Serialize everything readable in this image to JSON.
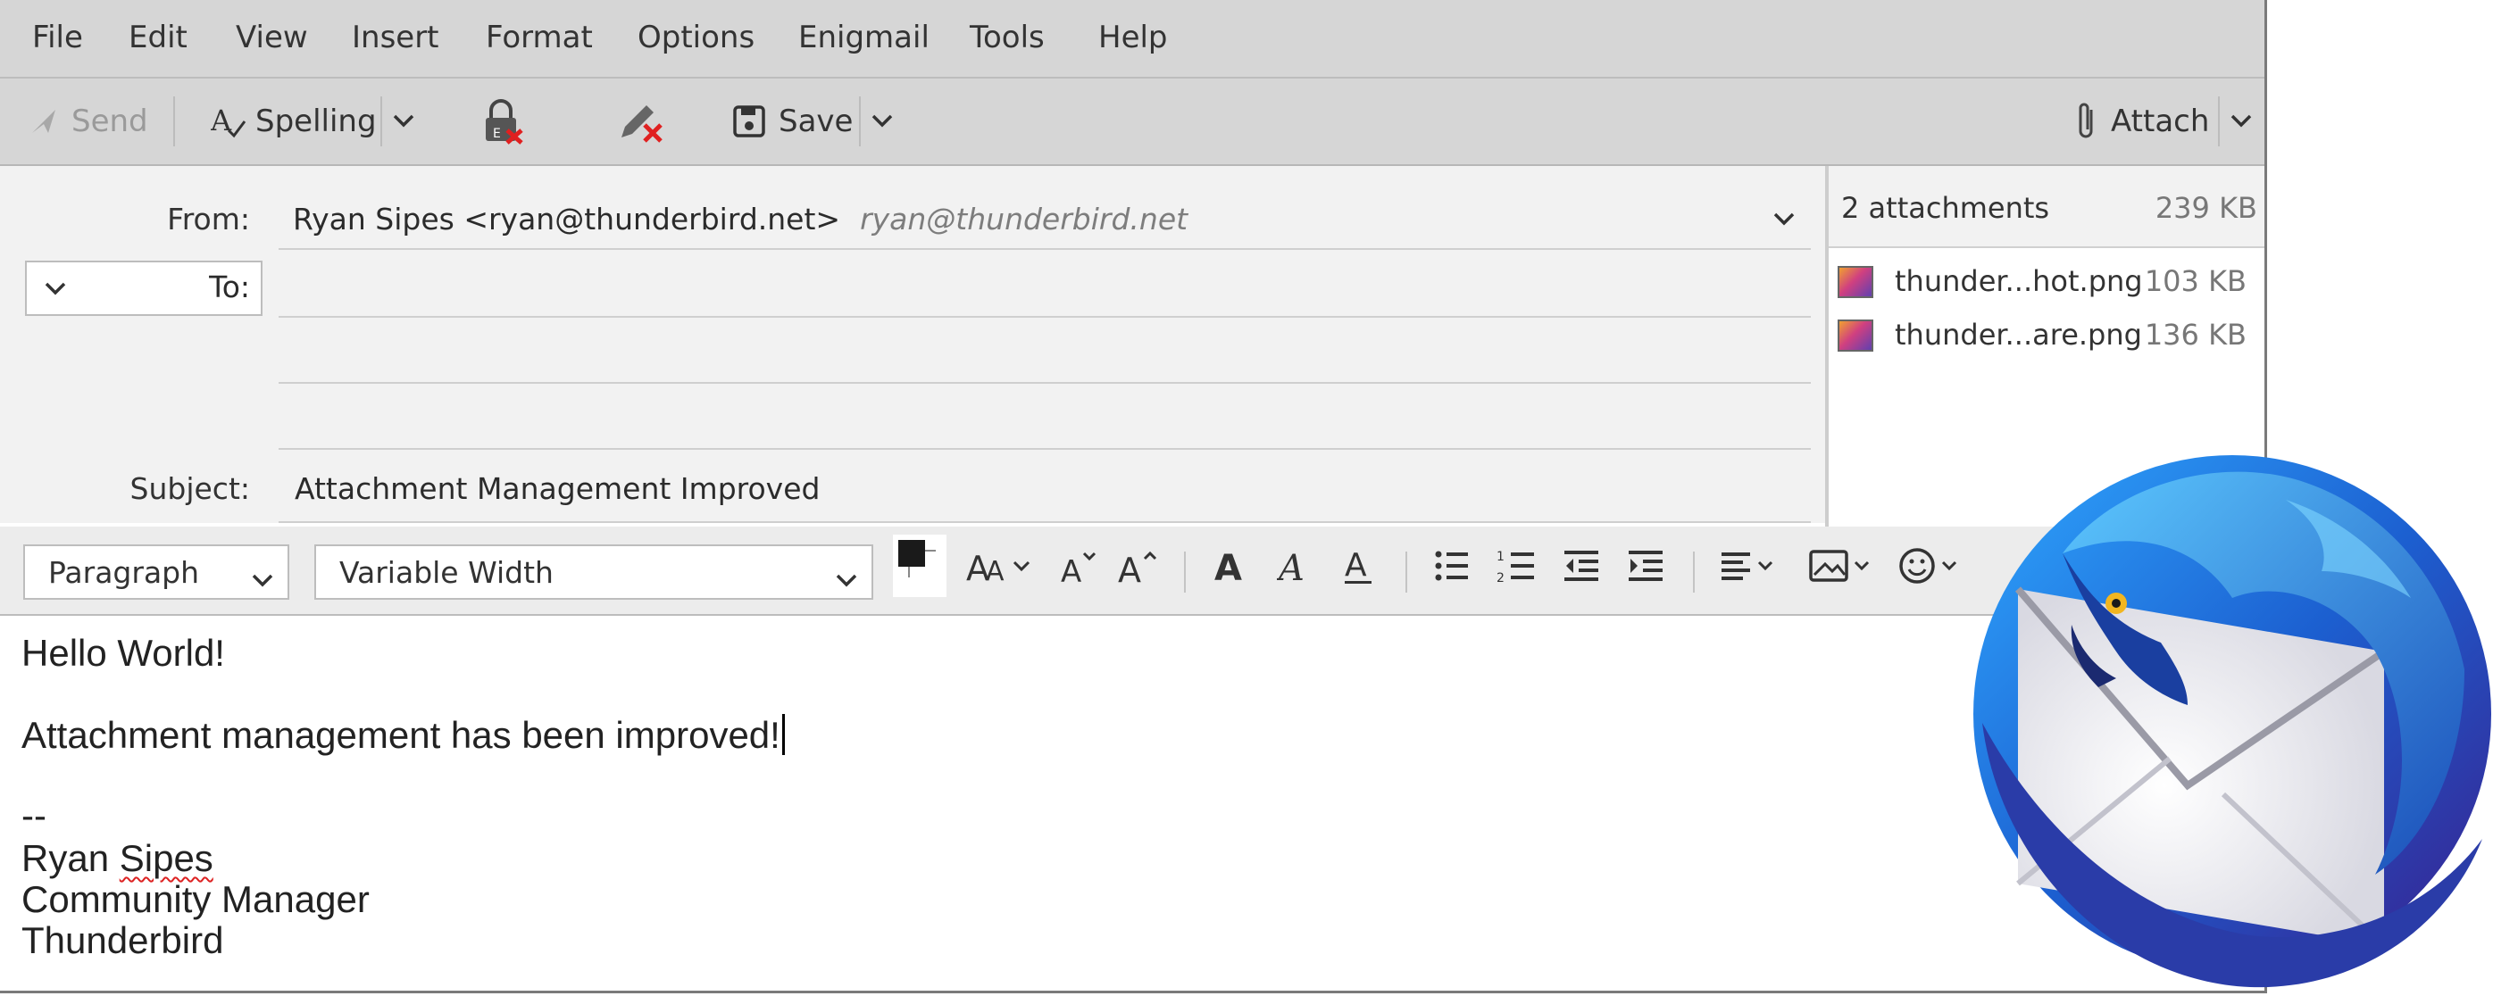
{
  "menu": [
    "File",
    "Edit",
    "View",
    "Insert",
    "Format",
    "Options",
    "Enigmail",
    "Tools",
    "Help"
  ],
  "toolbar": {
    "send_label": "Send",
    "spelling_label": "Spelling",
    "save_label": "Save",
    "attach_label": "Attach"
  },
  "header": {
    "from_label": "From:",
    "from_value": "Ryan Sipes <ryan@thunderbird.net>",
    "from_identity": "ryan@thunderbird.net",
    "to_label": "To:",
    "to_value": "",
    "subject_label": "Subject:",
    "subject_value": "Attachment Management Improved"
  },
  "attachments": {
    "summary": "2 attachments",
    "total_size": "239 KB",
    "items": [
      {
        "name": "thunder...hot.png",
        "size": "103 KB"
      },
      {
        "name": "thunder...are.png",
        "size": "136 KB"
      }
    ]
  },
  "format": {
    "paragraph_value": "Paragraph",
    "font_value": "Variable Width"
  },
  "message": {
    "greeting": "Hello World!",
    "line": "Attachment management has been improved!",
    "sig_sep": "--",
    "sig_first": "Ryan",
    "sig_last": "Sipes",
    "sig_title": "Community Manager",
    "sig_org": "Thunderbird"
  },
  "colors": {
    "chrome": "#d6d6d6",
    "header_bg": "#f2f2f2",
    "logo_blue": "#1f6fd6",
    "logo_purple": "#4a2a9a"
  },
  "icons": [
    "send-icon",
    "spelling-icon",
    "lock-icon",
    "pen-icon",
    "save-icon",
    "paperclip-icon",
    "chevron-down-icon",
    "image-icon",
    "emoji-icon",
    "thunderbird-logo"
  ]
}
